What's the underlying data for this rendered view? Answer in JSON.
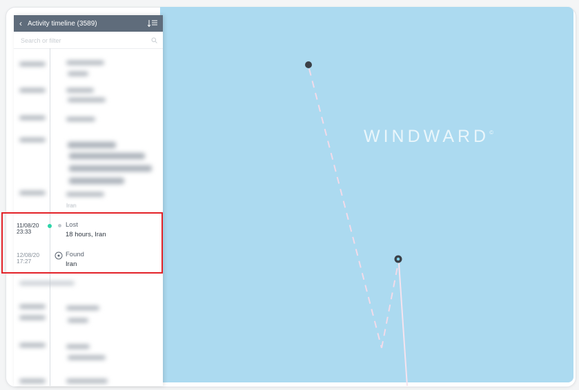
{
  "panel": {
    "back_icon": "chevron-left-icon",
    "title": "Activity timeline (3589)",
    "sort_icon": "sort-list-icon",
    "search_placeholder": "Search or filter",
    "search_icon": "search-icon"
  },
  "timeline": {
    "partial_above": "Iran",
    "events": [
      {
        "date": "11/08/20",
        "time": "23:33",
        "title": "Lost",
        "detail": "18 hours, Iran",
        "icon": "small-dot-icon"
      },
      {
        "date": "12/08/20",
        "time": "17:27",
        "title": "Found",
        "detail": "Iran",
        "icon": "found-circle-icon"
      }
    ]
  },
  "map": {
    "watermark": "WINDWARD",
    "watermark_mark": "©",
    "background": "#acdaf0",
    "track_color": "#f3d9e8",
    "vessel_color": "#3b4047"
  },
  "colors": {
    "highlight": "#e32127",
    "header": "#5f6c7b",
    "timeline_dot": "#2dd4a8"
  }
}
